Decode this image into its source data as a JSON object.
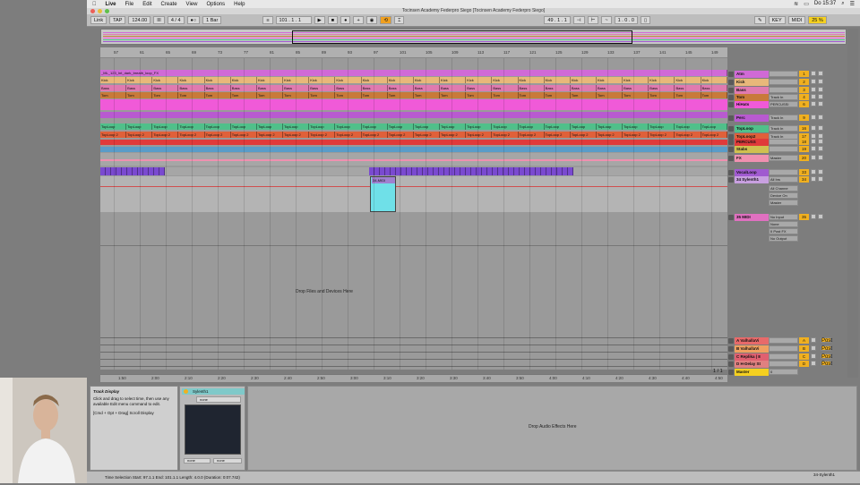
{
  "menubar": {
    "apple": "",
    "items": [
      "Live",
      "File",
      "Edit",
      "Create",
      "View",
      "Options",
      "Help"
    ],
    "right": [
      "Do 15:37"
    ]
  },
  "window": {
    "title": "Tocinsen Academy Federpro Siego  [Tocinsen Academy Federpro Siego]"
  },
  "control": {
    "link": "Link",
    "tap": "TAP",
    "tempo": "124.00",
    "sig": "4 / 4",
    "quant": "1 Bar",
    "pos": "101 .  1 .  1",
    "loop_start": "49 .  1 .  1",
    "loop_len": "1 .  0 .  0",
    "key": "KEY",
    "midi": "MIDI",
    "cpu": "25 %"
  },
  "ruler": {
    "bars": [
      "57",
      "61",
      "65",
      "69",
      "73",
      "77",
      "81",
      "85",
      "89",
      "93",
      "97",
      "101",
      "105",
      "109",
      "113",
      "117",
      "121",
      "125",
      "129",
      "133",
      "137",
      "141",
      "145",
      "149"
    ]
  },
  "time_axis": {
    "labels": [
      "1:50",
      "2:00",
      "2:10",
      "2:20",
      "2:30",
      "2:40",
      "2:50",
      "3:00",
      "3:10",
      "3:20",
      "3:30",
      "3:40",
      "3:50",
      "4:00",
      "4:10",
      "4:20",
      "4:30",
      "4:40",
      "4:50"
    ]
  },
  "arrangement": {
    "first_clip": "_ML_123_Int_dark_breath_loop_FX",
    "kick": "Kick",
    "bass": "Bass",
    "tom": "Tom",
    "toploop": "TopLoop",
    "toploop2": "TopLoop 2",
    "midi_clip": "34-MIDI",
    "drop": "Drop Files and Devices Here",
    "page": "1 / 1"
  },
  "mixer": {
    "tracks": [
      {
        "name": "Atm",
        "num": "1",
        "color": "#d06ad6",
        "route": ""
      },
      {
        "name": "Kick",
        "num": "2",
        "color": "#e8b87a",
        "route": ""
      },
      {
        "name": "Bass",
        "num": "3",
        "color": "#e07ab0",
        "route": ""
      },
      {
        "name": "Tom",
        "num": "4",
        "color": "#c87a3a",
        "route": "Track In"
      },
      {
        "name": "HiHats",
        "num": "6",
        "color": "#f05ad8",
        "route": "PERCUSSI"
      },
      {
        "name": "Perc",
        "num": "9",
        "color": "#b85ad0",
        "route": "Track In"
      },
      {
        "name": "TopLoop",
        "num": "16",
        "color": "#50c08a",
        "route": "Track In"
      },
      {
        "name": "TopLoop2",
        "num": "17",
        "color": "#e0603a",
        "route": "Track In"
      },
      {
        "name": "PERCUSS",
        "num": "18",
        "color": "#e03a3a",
        "route": ""
      },
      {
        "name": "Stabs",
        "num": "19",
        "color": "#d0c050",
        "route": ""
      },
      {
        "name": "FX",
        "num": "20",
        "color": "#f090b0",
        "route": "Master"
      },
      {
        "name": "VocalLoop",
        "num": "33",
        "color": "#a05ad0",
        "route": ""
      },
      {
        "name": "34 Sylenth1",
        "num": "34",
        "color": "#c8a0e0",
        "route": "All Ins"
      },
      {
        "name": "35 MIDI",
        "num": "35",
        "color": "#e070c0",
        "route": "No Input"
      }
    ],
    "returns": [
      {
        "name": "A ValhallaVi",
        "num": "A",
        "color": "#e86a6a"
      },
      {
        "name": "B ValhallaVi",
        "num": "B",
        "color": "#f0a060"
      },
      {
        "name": "C Replika | 8",
        "num": "C",
        "color": "#e06070"
      },
      {
        "name": "D H-Delay St",
        "num": "D",
        "color": "#e08080"
      }
    ],
    "master": {
      "name": "Master",
      "value": "0"
    },
    "io": {
      "all_channels": "All Channe",
      "device_on": "Device On",
      "auto": "Auto",
      "in": "In",
      "off": "Off",
      "master_out": "Master",
      "none": "None",
      "ii_post": "II Post FX",
      "no_output": "No Output",
      "synth": "Sylenth1",
      "post": "Post"
    }
  },
  "info": {
    "title": "Track Display",
    "body": "Click and drag to select time, then use any available Edit menu command to edit.",
    "shortcut": "[Cmd + Opt + Drag] Scroll Display"
  },
  "device": {
    "name": "Sylenth1",
    "preset": "none",
    "none": "none"
  },
  "fx": {
    "drop": "Drop Audio Effects Here"
  },
  "status": {
    "text": "Time Selection    Start: 97.1.1    End: 101.1.1    Length: 4.0.0    (Duration: 0:07.742)",
    "right": "34-Sylenth1"
  }
}
